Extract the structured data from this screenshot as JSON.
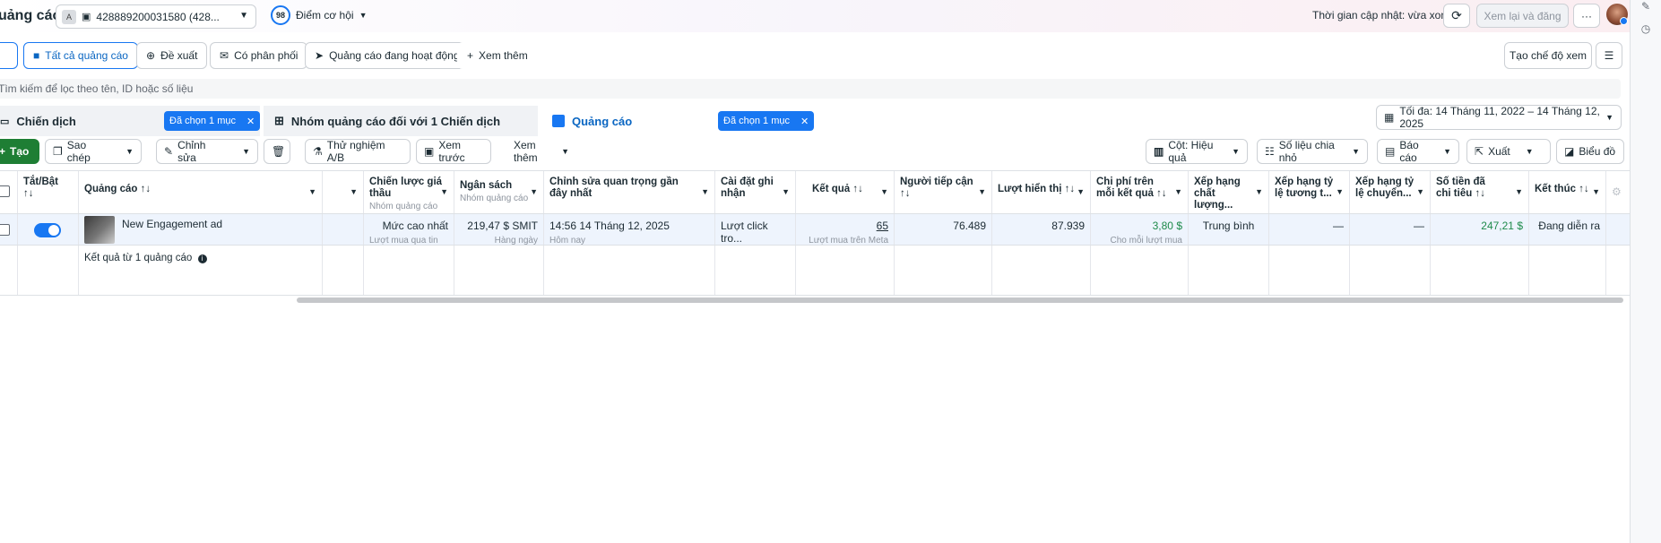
{
  "topbar": {
    "title": "uảng cáo",
    "account_badge": "A",
    "account_id": "428889200031580 (428...",
    "opportunity_score": "98",
    "opportunity_label": "Điểm cơ hội",
    "update_status": "Thời gian cập nhật: vừa xong",
    "review_publish": "Xem lại và đăng",
    "more": "···"
  },
  "filters": {
    "all_ads": "Tất cả quảng cáo",
    "suggestions": "Đề xuất",
    "delivery": "Có phân phối",
    "active_ads": "Quảng cáo đang hoạt động",
    "see_more": "Xem thêm",
    "create_view": "Tạo chế độ xem"
  },
  "search": {
    "placeholder": "Tìm kiếm để lọc theo tên, ID hoặc số liệu"
  },
  "tabs": {
    "campaigns": "Chiến dịch",
    "campaigns_chip": "Đã chọn 1 mục",
    "adsets": "Nhóm quảng cáo đối với 1 Chiến dịch",
    "ads": "Quảng cáo",
    "ads_chip": "Đã chọn 1 mục",
    "date_range": "Tối đa: 14 Tháng 11, 2022 – 14 Tháng 12, 2025"
  },
  "toolbar": {
    "create": "Tạo",
    "duplicate": "Sao chép",
    "edit": "Chỉnh sửa",
    "ab_test": "Thử nghiệm A/B",
    "preview": "Xem trước",
    "more": "Xem thêm",
    "columns": "Cột: Hiệu quả",
    "breakdown": "Số liệu chia nhỏ",
    "reports": "Báo cáo",
    "export": "Xuất",
    "charts": "Biểu đồ"
  },
  "table": {
    "headers": {
      "toggle": "Tắt/Bật",
      "toggle_sort": "↑↓",
      "ad": "Quảng cáo ↑↓",
      "bid": "Chiến lược giá thầu",
      "bid_sub": "Nhóm quảng cáo",
      "budget": "Ngân sách",
      "budget_sub": "Nhóm quảng cáo",
      "last_edit": "Chỉnh sửa quan trọng gần đây nhất",
      "attribution": "Cài đặt ghi nhận",
      "results": "Kết quả ↑↓",
      "reach": "Người tiếp cận",
      "reach_sort": "↑↓",
      "impressions": "Lượt hiển thị ↑↓",
      "cost_per_result": "Chi phí trên mỗi kết quả ↑↓",
      "quality": "Xếp hạng chất lượng...",
      "engagement_rank": "Xếp hạng tỷ lệ tương t...",
      "conversion_rank": "Xếp hạng tỷ lệ chuyển...",
      "amount_spent": "Số tiền đã chi tiêu ↑↓",
      "ends": "Kết thúc ↑↓"
    },
    "row": {
      "ad_name": "New Engagement ad",
      "bid": "Mức cao nhất",
      "bid_sub": "Lượt mua qua tin n...",
      "budget": "219,47 $ SMIT",
      "budget_sub": "Hàng ngày",
      "last_edit": "14:56 14 Tháng 12, 2025",
      "last_edit_sub": "Hôm nay",
      "attribution": "Lượt click tro...",
      "results": "65",
      "results_sub": "Lượt mua trên Meta",
      "reach": "76.489",
      "impressions": "87.939",
      "cost_per_result": "3,80 $",
      "cost_sub": "Cho mỗi lượt mua trê...",
      "quality": "Trung bình",
      "engagement_rank": "—",
      "conversion_rank": "—",
      "amount_spent": "247,21 $",
      "ends": "Đang diễn ra"
    },
    "summary": {
      "label": "Kết quả từ 1 quảng cáo"
    }
  },
  "colors": {
    "accent": "#1877f2",
    "create_button": "#1e7e34",
    "money_green": "#1d8a4a"
  }
}
